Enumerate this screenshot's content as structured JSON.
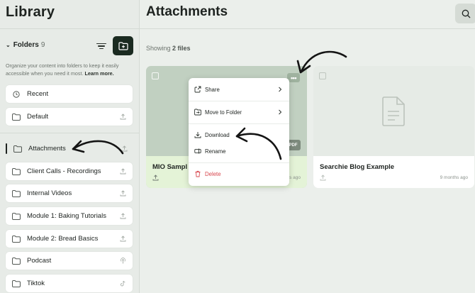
{
  "sidebar": {
    "title": "Library",
    "folders_label": "Folders",
    "folders_count": "9",
    "description": "Organize your content into folders to keep it easily accessible when you need it most.",
    "learn_more": "Learn more.",
    "items": [
      {
        "label": "Recent",
        "icon": "clock-icon",
        "right_icon": ""
      },
      {
        "label": "Default",
        "icon": "folder-icon",
        "right_icon": "upload-icon"
      },
      {
        "label": "Attachments",
        "icon": "folder-icon",
        "right_icon": "upload-icon",
        "active": true
      },
      {
        "label": "Client Calls - Recordings",
        "icon": "folder-icon",
        "right_icon": "upload-icon"
      },
      {
        "label": "Internal Videos",
        "icon": "folder-icon",
        "right_icon": "upload-icon"
      },
      {
        "label": "Module 1: Baking Tutorials",
        "icon": "folder-icon",
        "right_icon": "upload-icon"
      },
      {
        "label": "Module 2: Bread Basics",
        "icon": "folder-icon",
        "right_icon": "upload-icon"
      },
      {
        "label": "Podcast",
        "icon": "folder-icon",
        "right_icon": "podcast-icon"
      },
      {
        "label": "Tiktok",
        "icon": "folder-icon",
        "right_icon": "tiktok-icon"
      }
    ]
  },
  "main": {
    "title": "Attachments",
    "showing_prefix": "Showing",
    "showing_count": "2 files",
    "files": [
      {
        "name": "MIO Sampl",
        "date": "s ago",
        "badge": "PDF"
      },
      {
        "name": "Searchie Blog Example",
        "date": "9 months ago"
      }
    ]
  },
  "context_menu": {
    "items": [
      "Share",
      "Move to Folder",
      "Download",
      "Rename",
      "Delete"
    ],
    "more_label": "•••"
  },
  "colors": {
    "accent_dark": "#1a2a20",
    "danger": "#d8484f",
    "selected_card": "#c1d0c1",
    "selected_footer": "#e4f3d7"
  }
}
